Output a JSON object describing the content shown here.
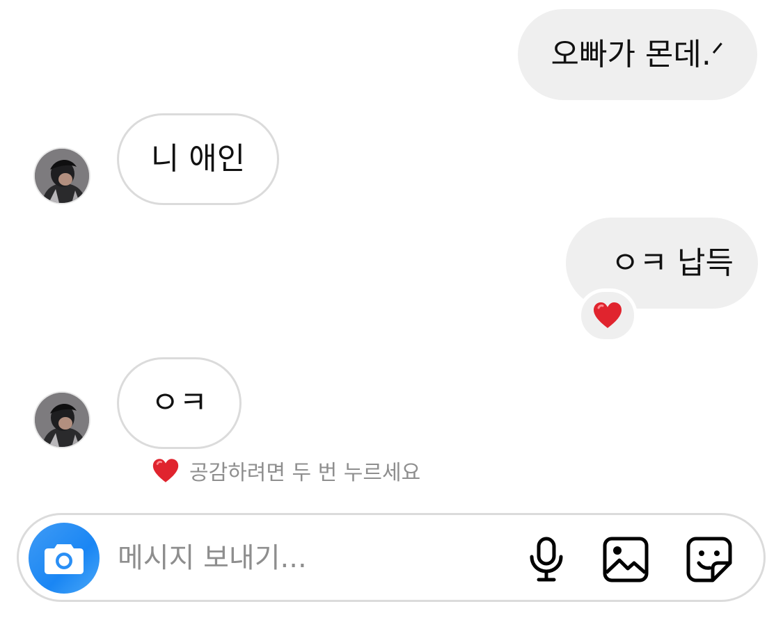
{
  "messages": [
    {
      "direction": "outgoing",
      "text": "오빠가 몬데.ᐟ"
    },
    {
      "direction": "incoming",
      "text": "니 애인"
    },
    {
      "direction": "outgoing",
      "text": "ㅇㅋ 납득",
      "reaction": "❤️"
    },
    {
      "direction": "incoming",
      "text": "ㅇㅋ"
    }
  ],
  "hint": {
    "emoji": "❤️",
    "text": "공감하려면 두 번 누르세요"
  },
  "composer": {
    "placeholder": "메시지 보내기...",
    "accent": "#1a86f4",
    "icons": [
      "camera-icon",
      "microphone-icon",
      "gallery-icon",
      "sticker-icon"
    ]
  }
}
